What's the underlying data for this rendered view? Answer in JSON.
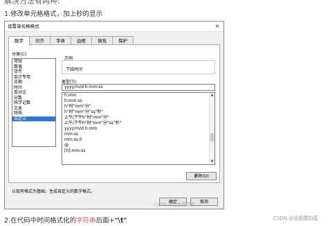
{
  "article": {
    "top_cut_text": "解决方法有两种:",
    "step1": "1.修改单元格格式，加上秒的显示",
    "step2_prefix": "2.在代码中时间格式化的",
    "step2_keyword": "字符串",
    "step2_mid": "后面+",
    "step2_suffix": "\"\\t\""
  },
  "dialog": {
    "title": "设置单元格格式",
    "close_symbol": "×",
    "tabs": [
      "数字",
      "对齐",
      "字体",
      "边框",
      "填充",
      "保护"
    ],
    "category_label": "分类(C):",
    "categories": [
      "常规",
      "数值",
      "货币",
      "会计专用",
      "日期",
      "时间",
      "百分比",
      "分数",
      "科学记数",
      "文本",
      "特殊",
      "自定义"
    ],
    "selected_category": "自定义",
    "sample_label": "示例",
    "sample_value": "下线时间",
    "type_label": "类型(T):",
    "type_value": "yyyy/m/d h:mm:ss",
    "format_list": [
      "h:mm",
      "h:mm:ss",
      "h\"时\"mm\"分\"",
      "h\"时\"mm\"分\"ss\"秒\"",
      "上午/下午h\"时\"mm\"分\"",
      "上午/下午h\"时\"mm\"分\"ss\"秒\"",
      "yyyy/m/d h:mm",
      "mm:ss",
      "mm:ss.0",
      "@",
      "[h]:mm:ss"
    ],
    "delete_button": "删除(D)",
    "description": "以现有格式为基础，生成自定义的数字格式。",
    "ok_button": "确定",
    "cancel_button": "取消"
  },
  "watermarks": {
    "dialog_wm": "CSDN @北极模的孤",
    "page_wm": "CSDN @北极模的孤"
  }
}
